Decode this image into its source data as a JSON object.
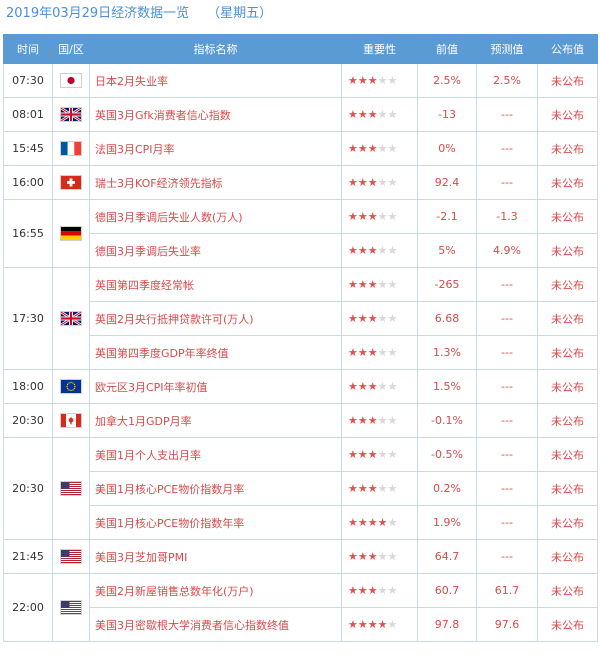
{
  "title": {
    "date": "2019年03月29日经济数据一览",
    "weekday": "（星期五）"
  },
  "headers": [
    "时间",
    "国/区",
    "指标名称",
    "重要性",
    "前值",
    "预测值",
    "公布值"
  ],
  "groups": [
    {
      "time": "07:30",
      "country": "日本",
      "flag": "japan-flag-icon",
      "rows": [
        {
          "name": "日本2月失业率",
          "stars": 3,
          "prev": "2.5%",
          "forecast": "2.5%",
          "actual": "未公布"
        }
      ]
    },
    {
      "time": "08:01",
      "country": "英国",
      "flag": "uk-flag-icon",
      "rows": [
        {
          "name": "英国3月Gfk消费者信心指数",
          "stars": 3,
          "prev": "-13",
          "forecast": "---",
          "actual": "未公布"
        }
      ]
    },
    {
      "time": "15:45",
      "country": "法国",
      "flag": "france-flag-icon",
      "rows": [
        {
          "name": "法国3月CPI月率",
          "stars": 3,
          "prev": "0%",
          "forecast": "---",
          "actual": "未公布"
        }
      ]
    },
    {
      "time": "16:00",
      "country": "瑞士",
      "flag": "switzerland-flag-icon",
      "rows": [
        {
          "name": "瑞士3月KOF经济领先指标",
          "stars": 3,
          "prev": "92.4",
          "forecast": "---",
          "actual": "未公布"
        }
      ]
    },
    {
      "time": "16:55",
      "country": "德国",
      "flag": "germany-flag-icon",
      "rows": [
        {
          "name": "德国3月季调后失业人数(万人)",
          "stars": 3,
          "prev": "-2.1",
          "forecast": "-1.3",
          "actual": "未公布"
        },
        {
          "name": "德国3月季调后失业率",
          "stars": 3,
          "prev": "5%",
          "forecast": "4.9%",
          "actual": "未公布"
        }
      ]
    },
    {
      "time": "17:30",
      "country": "英国",
      "flag": "uk-flag-icon",
      "rows": [
        {
          "name": "英国第四季度经常帐",
          "stars": 3,
          "prev": "-265",
          "forecast": "---",
          "actual": "未公布"
        },
        {
          "name": "英国2月央行抵押贷款许可(万人)",
          "stars": 3,
          "prev": "6.68",
          "forecast": "---",
          "actual": "未公布"
        },
        {
          "name": "英国第四季度GDP年率终值",
          "stars": 3,
          "prev": "1.3%",
          "forecast": "---",
          "actual": "未公布"
        }
      ]
    },
    {
      "time": "18:00",
      "country": "欧元区",
      "flag": "eu-flag-icon",
      "rows": [
        {
          "name": "欧元区3月CPI年率初值",
          "stars": 3,
          "prev": "1.5%",
          "forecast": "---",
          "actual": "未公布"
        }
      ]
    },
    {
      "time": "20:30",
      "country": "加拿大",
      "flag": "canada-flag-icon",
      "rows": [
        {
          "name": "加拿大1月GDP月率",
          "stars": 3,
          "prev": "-0.1%",
          "forecast": "---",
          "actual": "未公布"
        }
      ]
    },
    {
      "time": "20:30",
      "country": "美国",
      "flag": "usa-flag-icon",
      "rows": [
        {
          "name": "美国1月个人支出月率",
          "stars": 3,
          "prev": "-0.5%",
          "forecast": "---",
          "actual": "未公布"
        },
        {
          "name": "美国1月核心PCE物价指数月率",
          "stars": 3,
          "prev": "0.2%",
          "forecast": "---",
          "actual": "未公布"
        },
        {
          "name": "美国1月核心PCE物价指数年率",
          "stars": 4,
          "prev": "1.9%",
          "forecast": "---",
          "actual": "未公布"
        }
      ]
    },
    {
      "time": "21:45",
      "country": "美国",
      "flag": "usa-flag-icon",
      "rows": [
        {
          "name": "美国3月芝加哥PMI",
          "stars": 3,
          "prev": "64.7",
          "forecast": "---",
          "actual": "未公布"
        }
      ]
    },
    {
      "time": "22:00",
      "country": "美国",
      "flag": "usa-flag-icon",
      "rows": [
        {
          "name": "美国2月新屋销售总数年化(万户)",
          "stars": 3,
          "prev": "60.7",
          "forecast": "61.7",
          "actual": "未公布"
        },
        {
          "name": "美国3月密歇根大学消费者信心指数终值",
          "stars": 4,
          "prev": "97.8",
          "forecast": "97.6",
          "actual": "未公布"
        }
      ]
    }
  ],
  "colors": {
    "accent": "#5b9bd5",
    "value_text": "#d84a4a",
    "star_on": "#e05252",
    "star_off": "#d8d8d8"
  }
}
